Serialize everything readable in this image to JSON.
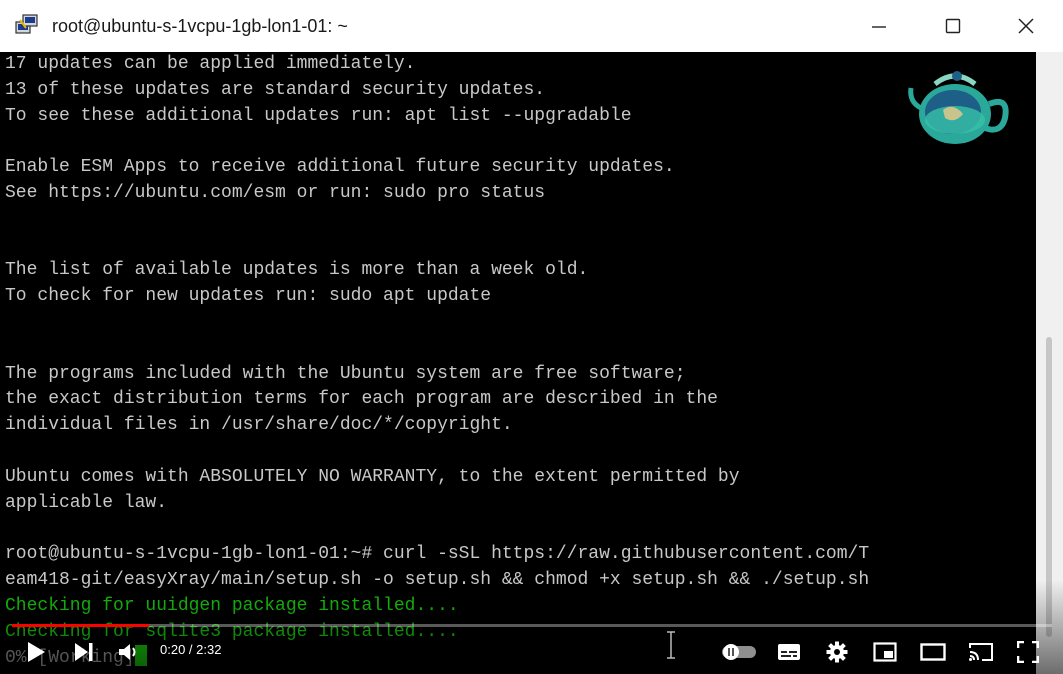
{
  "window": {
    "title": "root@ubuntu-s-1vcpu-1gb-lon1-01: ~",
    "minimize_icon": "minimize-icon",
    "maximize_icon": "maximize-icon",
    "close_icon": "close-icon"
  },
  "terminal": {
    "lines": [
      "17 updates can be applied immediately.",
      "13 of these updates are standard security updates.",
      "To see these additional updates run: apt list --upgradable",
      "",
      "Enable ESM Apps to receive additional future security updates.",
      "See https://ubuntu.com/esm or run: sudo pro status",
      "",
      "",
      "The list of available updates is more than a week old.",
      "To check for new updates run: sudo apt update",
      "",
      "",
      "The programs included with the Ubuntu system are free software;",
      "the exact distribution terms for each program are described in the",
      "individual files in /usr/share/doc/*/copyright.",
      "",
      "Ubuntu comes with ABSOLUTELY NO WARRANTY, to the extent permitted by",
      "applicable law.",
      "",
      "root@ubuntu-s-1vcpu-1gb-lon1-01:~# curl -sSL https://raw.githubusercontent.com/T",
      "eam418-git/easyXray/main/setup.sh -o setup.sh && chmod +x setup.sh && ./setup.sh"
    ],
    "status_lines": [
      "Checking for uuidgen package installed....",
      "Checking for sqlite3 package installed...."
    ],
    "working_line": "0% [Working]"
  },
  "player": {
    "time_display": "0:20 / 2:32",
    "progress_fraction": 0.1316,
    "accent_color": "#ff0000",
    "icons": [
      "play-icon",
      "next-icon",
      "volume-icon",
      "autoplay-toggle-icon",
      "subtitles-icon",
      "settings-icon",
      "miniplayer-icon",
      "theater-icon",
      "cast-icon",
      "fullscreen-icon"
    ]
  }
}
